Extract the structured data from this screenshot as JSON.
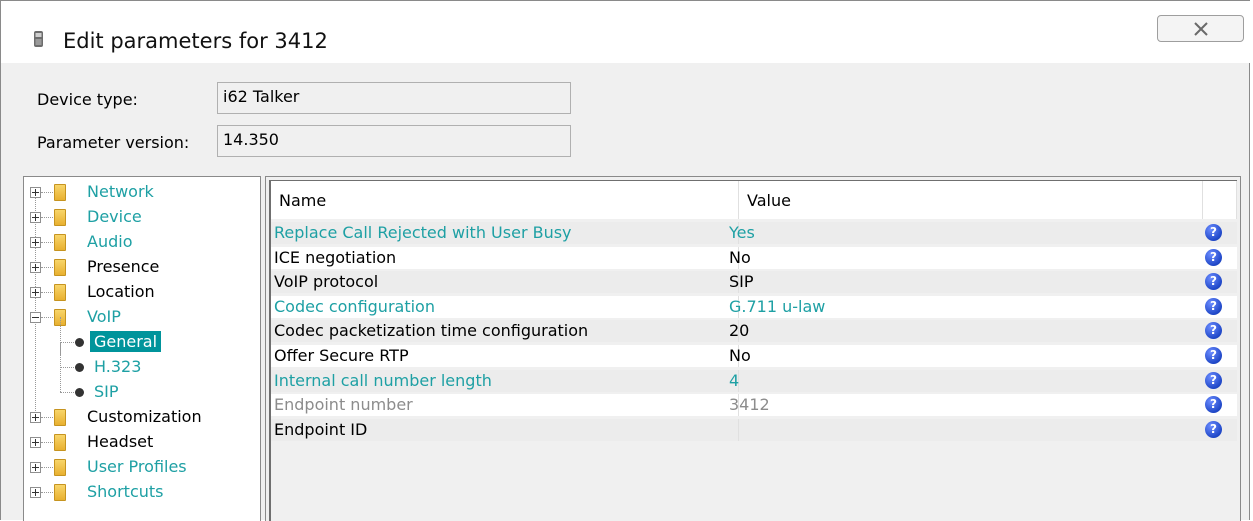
{
  "window": {
    "title": "Edit parameters for 3412",
    "close_icon": "close-x-icon"
  },
  "fields": {
    "device_type_label": "Device type:",
    "device_type_value": "i62 Talker",
    "param_version_label": "Parameter version:",
    "param_version_value": "14.350"
  },
  "tree": {
    "nodes": [
      {
        "label": "Network",
        "style": "teal",
        "expand": "plus"
      },
      {
        "label": "Device",
        "style": "teal",
        "expand": "plus"
      },
      {
        "label": "Audio",
        "style": "teal",
        "expand": "plus"
      },
      {
        "label": "Presence",
        "style": "black",
        "expand": "plus"
      },
      {
        "label": "Location",
        "style": "black",
        "expand": "plus"
      },
      {
        "label": "VoIP",
        "style": "teal",
        "expand": "minus"
      },
      {
        "label": "General",
        "style": "selected",
        "child": true
      },
      {
        "label": "H.323",
        "style": "teal",
        "child": true
      },
      {
        "label": "SIP",
        "style": "teal",
        "child": true
      },
      {
        "label": "Customization",
        "style": "black",
        "expand": "plus"
      },
      {
        "label": "Headset",
        "style": "black",
        "expand": "plus"
      },
      {
        "label": "User Profiles",
        "style": "teal",
        "expand": "plus"
      },
      {
        "label": "Shortcuts",
        "style": "teal",
        "expand": "plus"
      }
    ]
  },
  "grid": {
    "columns": [
      "Name",
      "Value"
    ],
    "help_icon": "question-mark-icon",
    "rows": [
      {
        "name": "Replace Call Rejected with User Busy",
        "value": "Yes",
        "style": "teal"
      },
      {
        "name": "ICE negotiation",
        "value": "No",
        "style": "black"
      },
      {
        "name": "VoIP protocol",
        "value": "SIP",
        "style": "black"
      },
      {
        "name": "Codec configuration",
        "value": "G.711 u-law",
        "style": "teal"
      },
      {
        "name": "Codec packetization time configuration",
        "value": "20",
        "style": "black"
      },
      {
        "name": "Offer Secure RTP",
        "value": "No",
        "style": "black"
      },
      {
        "name": "Internal call number length",
        "value": "4",
        "style": "teal"
      },
      {
        "name": "Endpoint number",
        "value": "3412",
        "style": "gray"
      },
      {
        "name": "Endpoint ID",
        "value": "",
        "style": "black"
      }
    ]
  },
  "colors": {
    "accent_teal": "#1ea0a4",
    "selection_bg": "#00949b",
    "help_icon_blue": "#2048c8"
  }
}
